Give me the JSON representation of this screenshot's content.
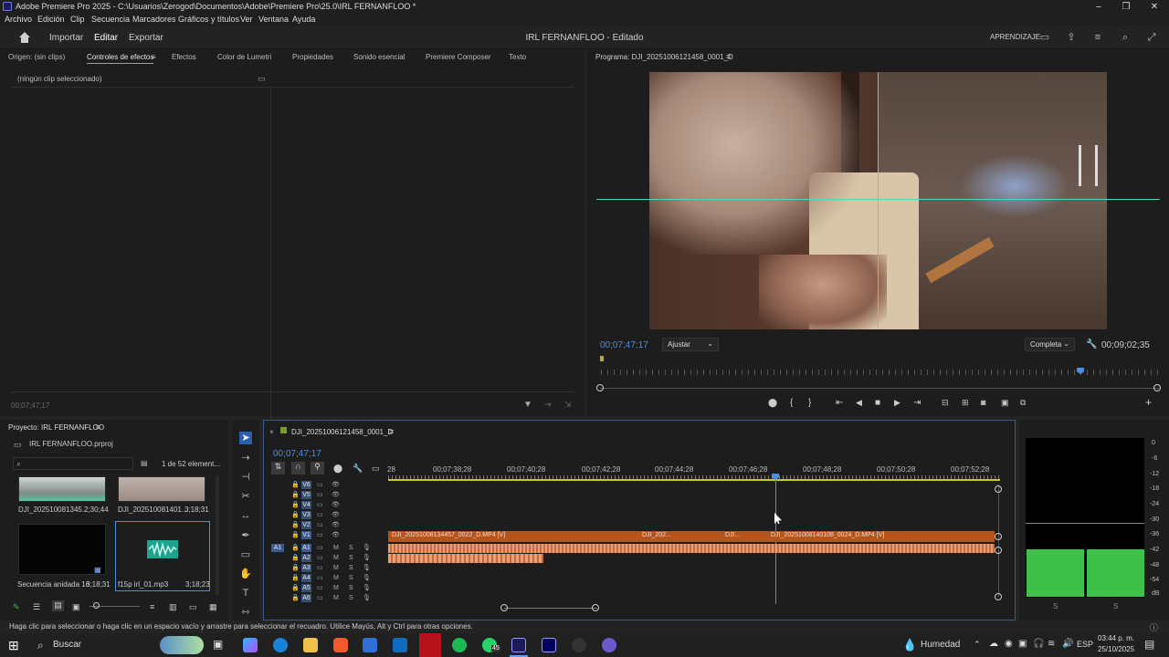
{
  "window": {
    "title": "Adobe Premiere Pro 2025 - C:\\Usuarios\\Zerogod\\Documentos\\Adobe\\Premiere Pro\\25.0\\IRL FERNANFLOO *"
  },
  "menu": [
    "Archivo",
    "Edición",
    "Clip",
    "Secuencia",
    "Marcadores",
    "Gráficos y títulos",
    "Ver",
    "Ventana",
    "Ayuda"
  ],
  "workspace": {
    "tabs": [
      "Importar",
      "Editar",
      "Exportar"
    ],
    "active_tab": "Editar",
    "project_title": "IRL FERNANFLOO - Editado",
    "learn_label": "APRENDIZAJE"
  },
  "effects_panel": {
    "tabs": [
      "Origen: (sin clips)",
      "Controles de efectos",
      "Efectos",
      "Color de Lumetri",
      "Propiedades",
      "Sonido esencial",
      "Premiere Composer",
      "Texto"
    ],
    "active_tab": "Controles de efectos",
    "empty_message": "(ningún clip seleccionado)",
    "timecode": "00;07;47;17"
  },
  "program_monitor": {
    "title": "Programa: DJI_20251006121458_0001_D",
    "current_time": "00;07;47;17",
    "fit_label": "Ajustar",
    "resolution_label": "Completa",
    "duration": "00;09;02;35"
  },
  "project_panel": {
    "title": "Proyecto: IRL FERNANFLOO",
    "file": "IRL FERNANFLOO.prproj",
    "count": "1 de 52 element...",
    "items": [
      {
        "name": "DJI_202510081345...",
        "duration": "2;30;44"
      },
      {
        "name": "DJI_202510081401...",
        "duration": "3;18;31"
      },
      {
        "name": "Secuencia anidada 16",
        "duration": "3;18;31"
      },
      {
        "name": "f15p irl_01.mp3",
        "duration": "3;18;23"
      }
    ]
  },
  "timeline": {
    "sequence_name": "DJI_20251006121458_0001_D",
    "timecode": "00;07;47;17",
    "ruler": [
      "28",
      "00;07;38;28",
      "00;07;40;28",
      "00;07;42;28",
      "00;07;44;28",
      "00;07;46;28",
      "00;07;48;28",
      "00;07;50;28",
      "00;07;52;28"
    ],
    "video_tracks": [
      "V6",
      "V5",
      "V4",
      "V3",
      "V2",
      "V1"
    ],
    "audio_tracks": [
      "A1",
      "A2",
      "A3",
      "A4",
      "A5",
      "A6"
    ],
    "source_patch": "A1",
    "clips": [
      {
        "label": "DJI_20251008134457_0022_D.MP4 [V]"
      },
      {
        "label": "DJI_202..."
      },
      {
        "label": "DJI..."
      },
      {
        "label": "DJI_20251008140108_0024_D.MP4 [V]"
      }
    ]
  },
  "meter": {
    "scale": [
      "0",
      "-6",
      "-12",
      "-18",
      "-24",
      "-30",
      "-36",
      "-42",
      "-48",
      "-54",
      "dB"
    ],
    "solo": [
      "S",
      "S"
    ]
  },
  "status_bar": "Haga clic para seleccionar o haga clic en un espacio vacío y arrastre para seleccionar el recuadro. Utilice Mayús, Alt y Ctrl para otras opciones.",
  "taskbar": {
    "search": "Buscar",
    "whatsapp_badge": "45",
    "weather": "Humedad",
    "lang": "ESP",
    "time": "03:44 p. m.",
    "date": "25/10/2025"
  }
}
